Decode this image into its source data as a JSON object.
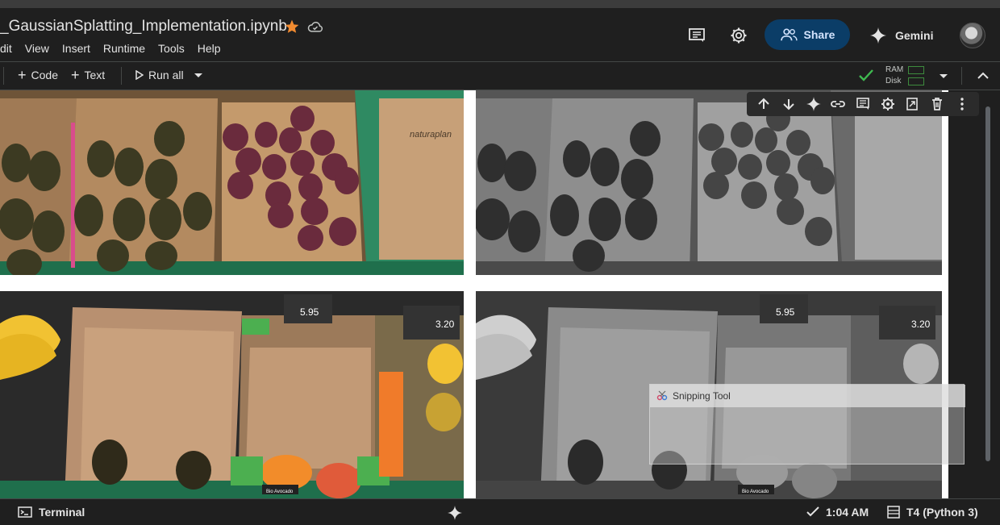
{
  "notebook": {
    "title": "_GaussianSplatting_Implementation.ipynb",
    "star_icon": "star-icon",
    "cloud_icon": "cloud-saved-icon"
  },
  "menu": {
    "items": [
      "dit",
      "View",
      "Insert",
      "Runtime",
      "Tools",
      "Help"
    ]
  },
  "header": {
    "share_label": "Share",
    "gemini_label": "Gemini",
    "accent": "#0b3d67"
  },
  "toolbar": {
    "code_label": "Code",
    "text_label": "Text",
    "run_all_label": "Run all",
    "ram_label": "RAM",
    "disk_label": "Disk",
    "status_color": "#3fb950"
  },
  "snipping_tool": {
    "title": "Snipping Tool"
  },
  "statusbar": {
    "terminal_label": "Terminal",
    "time_label": "1:04 AM",
    "runtime_label": "T4 (Python 3)"
  },
  "images": {
    "avocado_label": "Bio Avocado",
    "price_1": "5.95",
    "price_2": "3.20",
    "brand_text": "naturaplan"
  }
}
